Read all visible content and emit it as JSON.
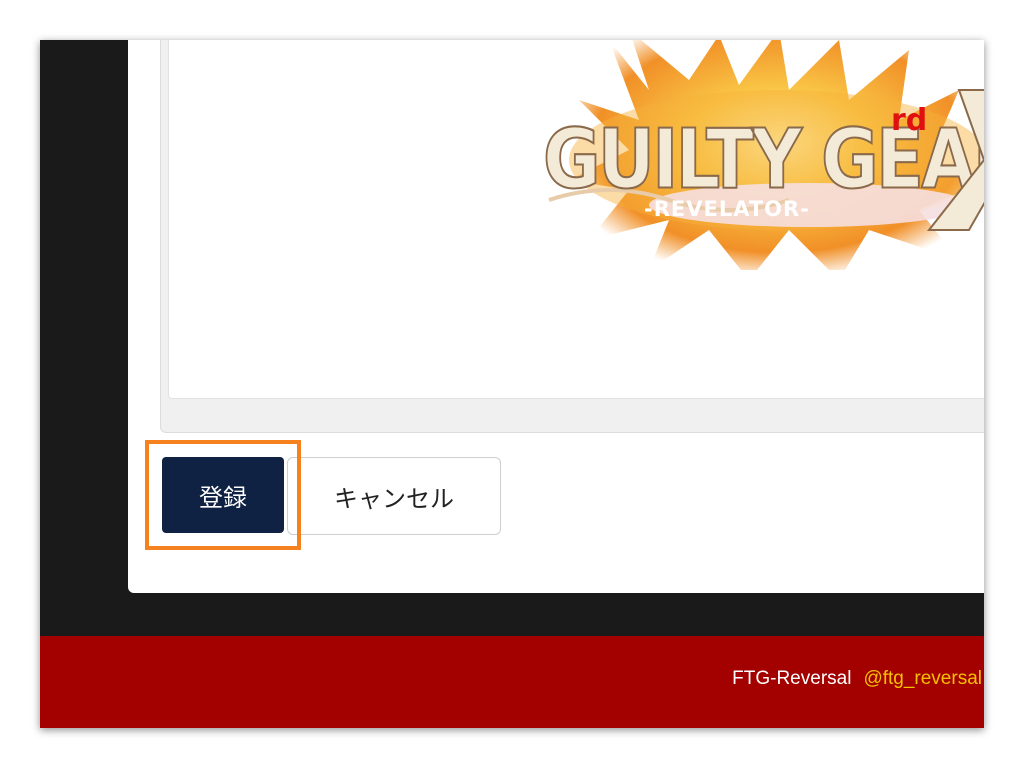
{
  "form": {
    "submit_label": "登録",
    "cancel_label": "キャンセル"
  },
  "logo": {
    "title": "GUILTY GEAR",
    "superscript": "rd",
    "subtitle": "-REVELATOR-"
  },
  "footer": {
    "brand": "FTG-Reversal",
    "twitter_handle": "@ftg_reversal"
  },
  "colors": {
    "submit_bg": "#0f2244",
    "footer_bg": "#a30000",
    "highlight": "#f5821f",
    "handle": "#f5c000"
  }
}
